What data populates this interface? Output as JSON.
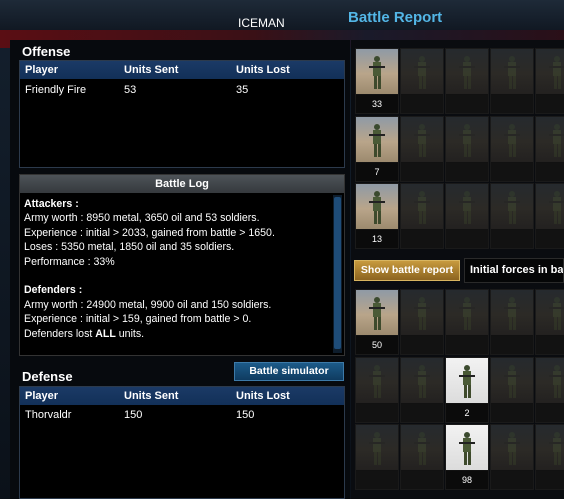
{
  "header": {
    "username": "ICEMAN",
    "title": "Battle Report"
  },
  "offense": {
    "title": "Offense",
    "columns": [
      "Player",
      "Units Sent",
      "Units Lost"
    ],
    "rows": [
      {
        "player": "Friendly Fire",
        "sent": "53",
        "lost": "35"
      }
    ]
  },
  "battle_log": {
    "title": "Battle Log",
    "attackers_label": "Attackers :",
    "attackers": [
      "Army worth : 8950 metal, 3650 oil and 53 soldiers.",
      "Experience : initial > 2033, gained from battle > 1650.",
      "Loses : 5350 metal, 1850 oil and 35 soldiers.",
      "Performance : 33%"
    ],
    "defenders_label": "Defenders :",
    "defenders": [
      "Army worth : 24900 metal, 9900 oil and 150 soldiers.",
      "Experience : initial > 159, gained from battle > 0."
    ],
    "defenders_lost_prefix": "Defenders lost ",
    "defenders_lost_bold": "ALL",
    "defenders_lost_suffix": " units."
  },
  "defense": {
    "title": "Defense",
    "simulator_label": "Battle simulator",
    "columns": [
      "Player",
      "Units Sent",
      "Units Lost"
    ],
    "rows": [
      {
        "player": "Thorvaldr",
        "sent": "150",
        "lost": "150"
      }
    ]
  },
  "buttons": {
    "show_report": "Show battle report"
  },
  "forces_label": "Initial forces in ba",
  "attacker_units": [
    {
      "count": "33"
    },
    {
      "count": "7"
    },
    {
      "count": "13"
    }
  ],
  "defender_units": [
    {
      "count": "50",
      "col": 0
    },
    {
      "count": "2",
      "col": 2
    },
    {
      "count": "98",
      "col": 2
    }
  ]
}
